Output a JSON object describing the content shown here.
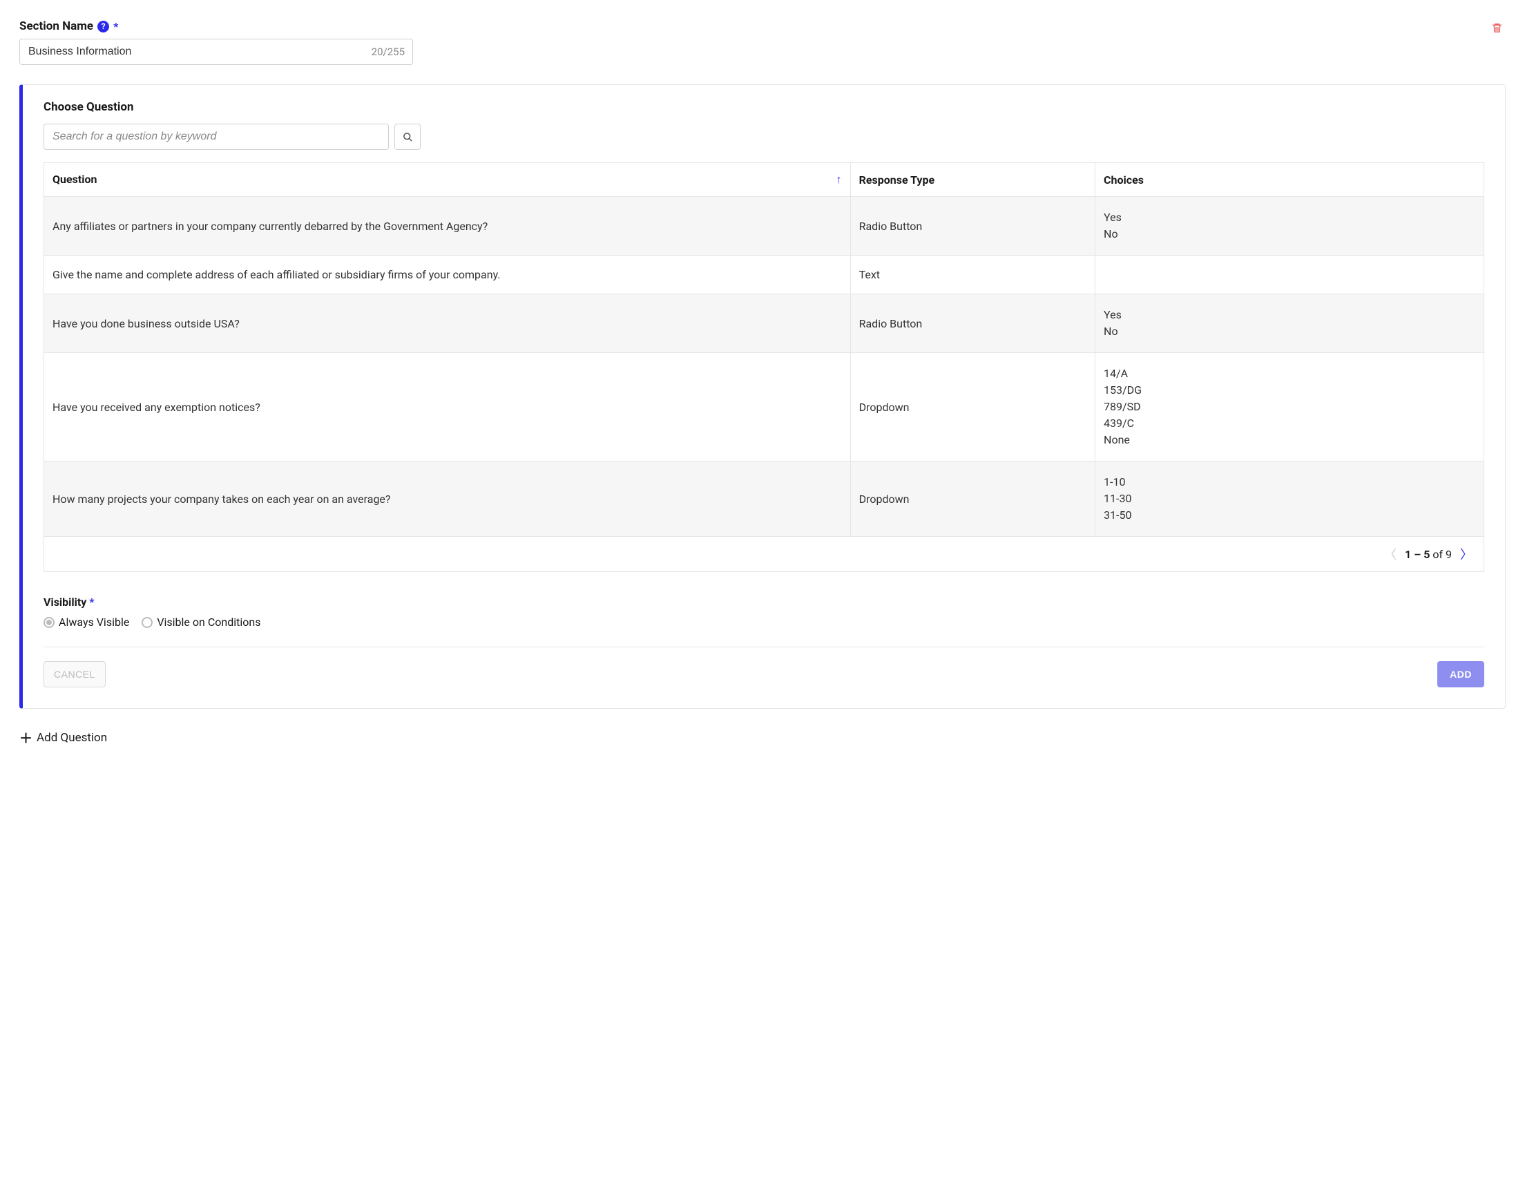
{
  "section": {
    "name_label": "Section Name",
    "name_value": "Business Information",
    "char_count": "20/255"
  },
  "choose": {
    "label": "Choose Question",
    "search_placeholder": "Search for a question by keyword"
  },
  "table": {
    "headers": {
      "question": "Question",
      "response": "Response Type",
      "choices": "Choices"
    },
    "rows": [
      {
        "question": "Any affiliates or partners in your company currently debarred by the Government Agency?",
        "response": "Radio Button",
        "choices": [
          "Yes",
          "No"
        ]
      },
      {
        "question": "Give the name and complete address of each affiliated or subsidiary firms of your company.",
        "response": "Text",
        "choices": []
      },
      {
        "question": "Have you done business outside USA?",
        "response": "Radio Button",
        "choices": [
          "Yes",
          "No"
        ]
      },
      {
        "question": "Have you received any exemption notices?",
        "response": "Dropdown",
        "choices": [
          "14/A",
          "153/DG",
          "789/SD",
          "439/C",
          "None"
        ]
      },
      {
        "question": "How many projects your company takes on each year on an average?",
        "response": "Dropdown",
        "choices": [
          "1-10",
          "11-30",
          "31-50"
        ]
      }
    ]
  },
  "pagination": {
    "range": "1 – 5",
    "of_label": "of",
    "total": "9"
  },
  "visibility": {
    "label": "Visibility",
    "always": "Always Visible",
    "conditions": "Visible on Conditions"
  },
  "buttons": {
    "cancel": "CANCEL",
    "add": "ADD",
    "add_question": "Add Question"
  }
}
